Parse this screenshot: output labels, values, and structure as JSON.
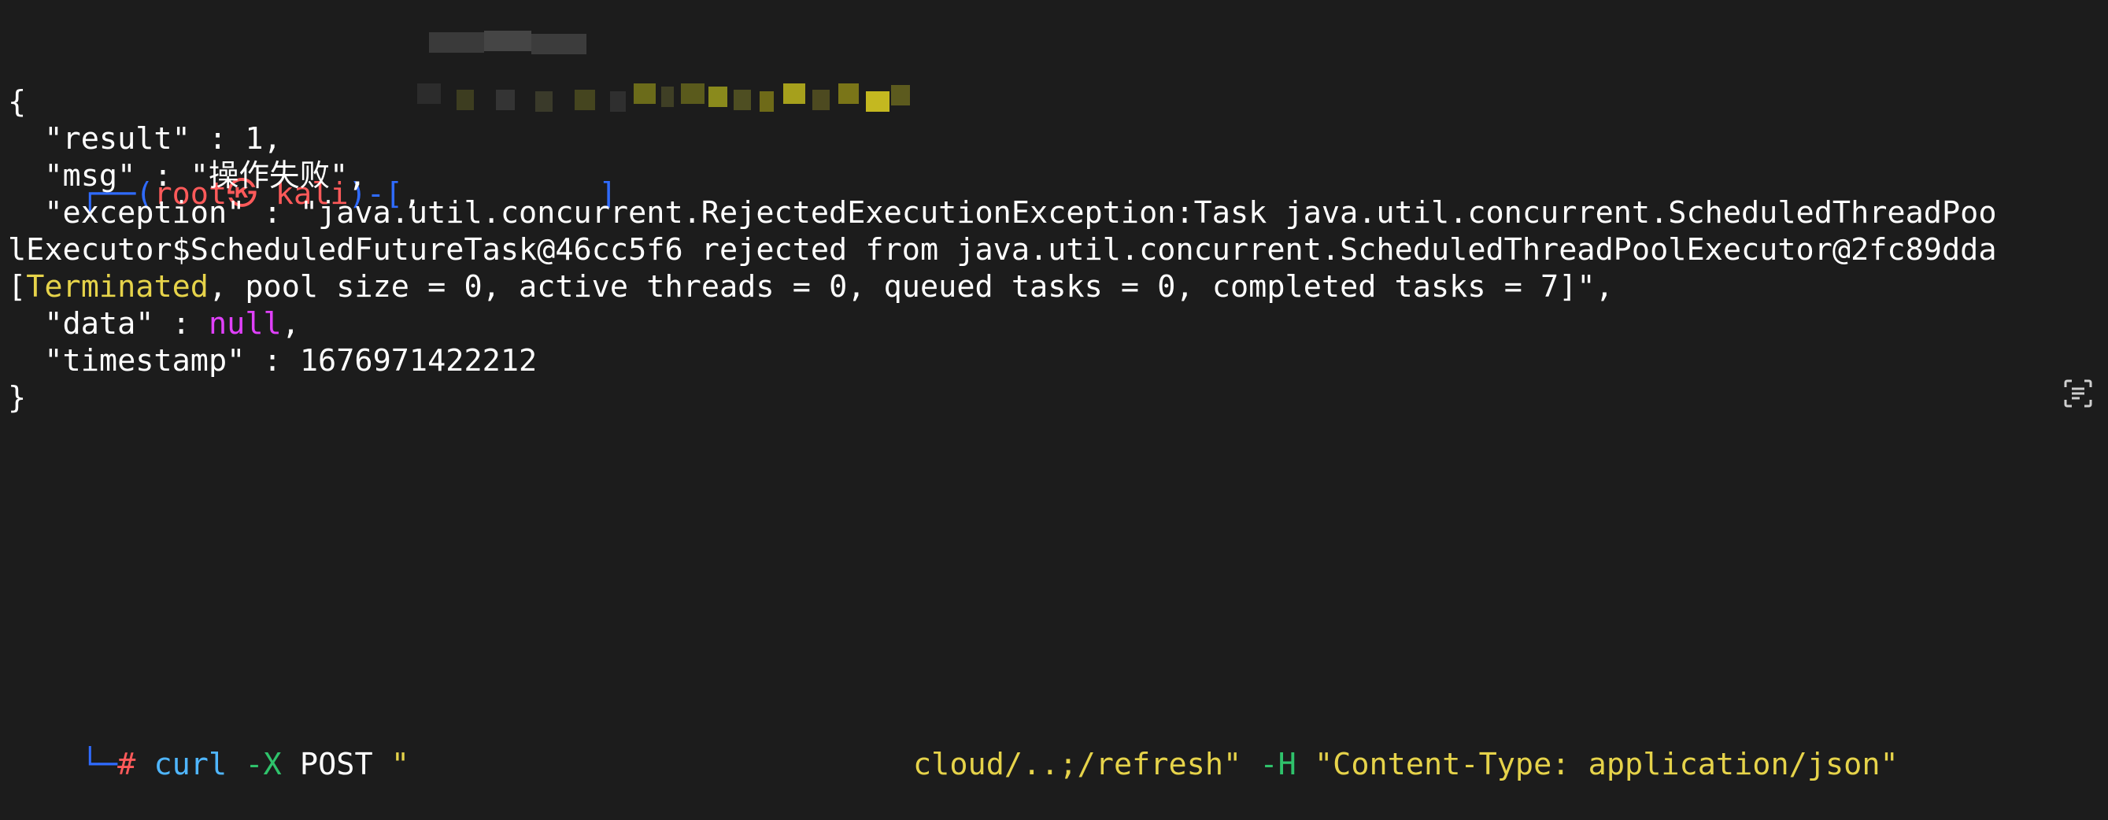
{
  "prompt": {
    "box_top": "┌──(",
    "user": "root",
    "skull": "㉿",
    "host": "kali",
    "dir_sep": ")-[",
    "dir_prefix": ",",
    "dir_close": "]",
    "box_bottom": "└─",
    "hash": "#"
  },
  "command": {
    "program": "curl",
    "flag_x": "-X",
    "method": "POST",
    "url_open_quote": "\"",
    "url_tail": "cloud/..;/refresh\"",
    "flag_h": "-H",
    "header": "\"Content-Type: application/json\""
  },
  "output": {
    "open_brace": "{",
    "result_line": "  \"result\" : 1,",
    "msg_line": "  \"msg\" : \"操作失败\",",
    "exception_line1": "  \"exception\" : \"java.util.concurrent.RejectedExecutionException:Task java.util.concurrent.ScheduledThreadPoo",
    "exception_line2": "lExecutor$ScheduledFutureTask@46cc5f6 rejected from java.util.concurrent.ScheduledThreadPoolExecutor@2fc89dda",
    "exception_line3_bracket": "[",
    "exception_line3_terminated": "Terminated",
    "exception_line3_rest": ", pool size = 0, active threads = 0, queued tasks = 0, completed tasks = 7]\",",
    "data_key": "  \"data\" : ",
    "data_value": "null",
    "data_comma": ",",
    "timestamp_line": "  \"timestamp\" : 1676971422212",
    "close_brace": "}"
  },
  "colors": {
    "background": "#1c1c1c",
    "prompt_frame": "#2f6bff",
    "prompt_user": "#ff5a5a",
    "command": "#4fb6ff",
    "flags": "#2fc26b",
    "strings": "#e6d34a",
    "null": "#e040fb"
  },
  "icons": {
    "corner": "screen-text-scan-icon"
  }
}
